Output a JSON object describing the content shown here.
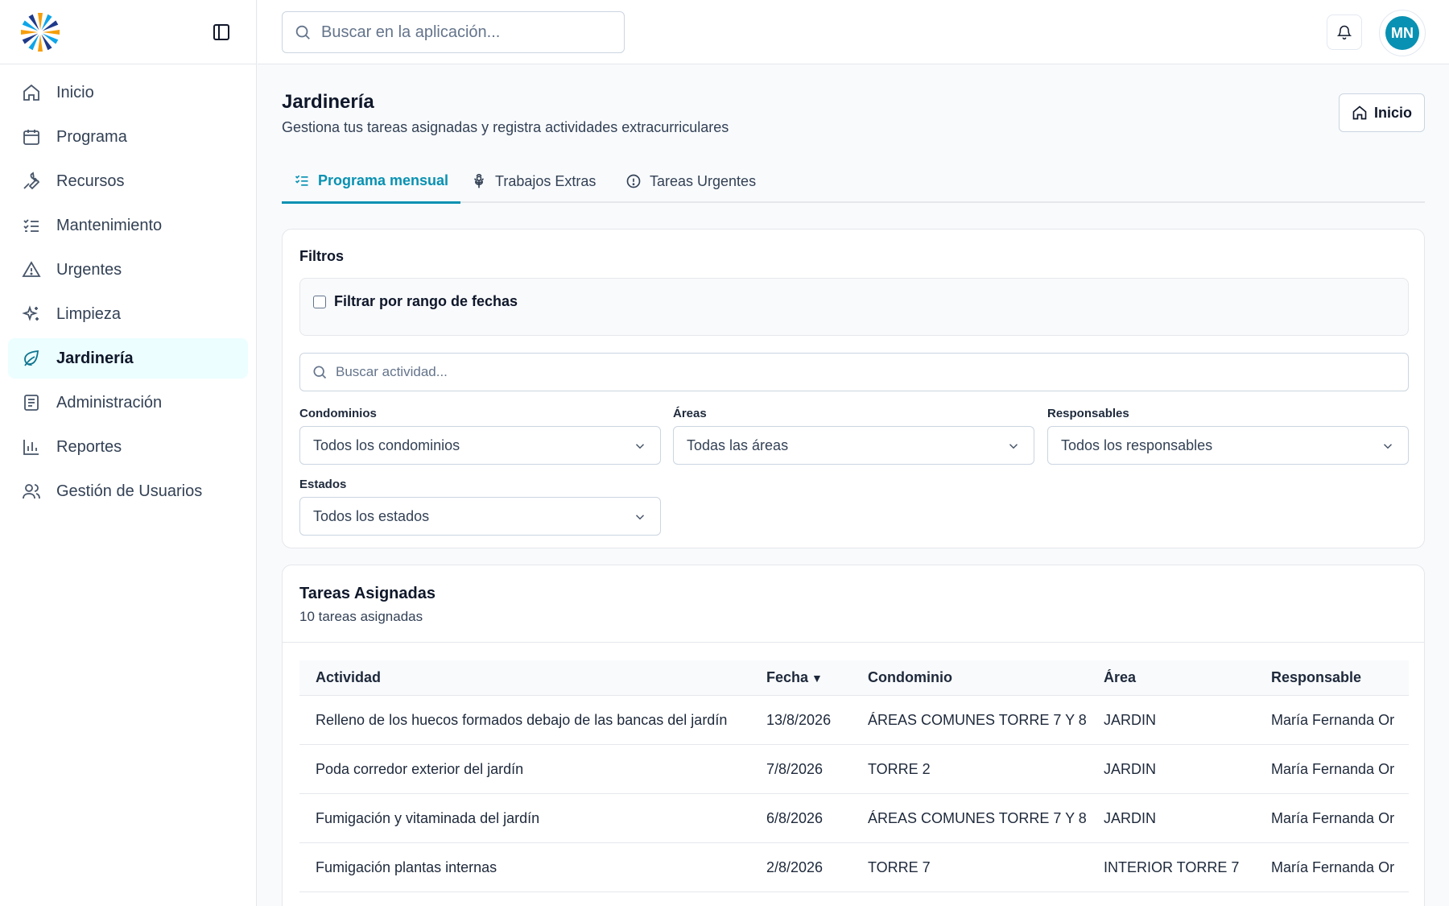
{
  "topbar": {
    "search_placeholder": "Buscar en la aplicación...",
    "avatar_initials": "MN"
  },
  "sidebar": {
    "items": [
      {
        "label": "Inicio",
        "icon": "home-icon"
      },
      {
        "label": "Programa",
        "icon": "calendar-icon"
      },
      {
        "label": "Recursos",
        "icon": "wrench-icon"
      },
      {
        "label": "Mantenimiento",
        "icon": "list-checks-icon"
      },
      {
        "label": "Urgentes",
        "icon": "alert-triangle-icon"
      },
      {
        "label": "Limpieza",
        "icon": "sparkles-icon"
      },
      {
        "label": "Jardinería",
        "icon": "leaf-icon",
        "active": true
      },
      {
        "label": "Administración",
        "icon": "document-icon"
      },
      {
        "label": "Reportes",
        "icon": "bar-chart-icon"
      },
      {
        "label": "Gestión de Usuarios",
        "icon": "users-icon"
      }
    ]
  },
  "header": {
    "title": "Jardinería",
    "subtitle": "Gestiona tus tareas asignadas y registra actividades extracurriculares",
    "home_button": "Inicio"
  },
  "tabs": [
    {
      "label": "Programa mensual",
      "icon": "list-checks-icon",
      "active": true
    },
    {
      "label": "Trabajos Extras",
      "icon": "flower-icon"
    },
    {
      "label": "Tareas Urgentes",
      "icon": "alert-circle-icon"
    }
  ],
  "filters": {
    "title": "Filtros",
    "date_range_label": "Filtrar por rango de fechas",
    "activity_search_placeholder": "Buscar actividad...",
    "condominios": {
      "label": "Condominios",
      "value": "Todos los condominios"
    },
    "areas": {
      "label": "Áreas",
      "value": "Todas las áreas"
    },
    "responsables": {
      "label": "Responsables",
      "value": "Todos los responsables"
    },
    "estados": {
      "label": "Estados",
      "value": "Todos los estados"
    }
  },
  "tasks": {
    "title": "Tareas Asignadas",
    "count_text": "10 tareas asignadas",
    "columns": [
      "Actividad",
      "Fecha",
      "Condominio",
      "Área",
      "Responsable"
    ],
    "sort_indicator": "▼",
    "rows": [
      [
        "Relleno de los huecos formados debajo de las bancas del jardín",
        "13/8/2026",
        "ÁREAS COMUNES TORRE 7 Y 8",
        "JARDIN",
        "María Fernanda Or"
      ],
      [
        "Poda corredor exterior del jardín",
        "7/8/2026",
        "TORRE 2",
        "JARDIN",
        "María Fernanda Or"
      ],
      [
        "Fumigación y vitaminada del jardín",
        "6/8/2026",
        "ÁREAS COMUNES TORRE 7 Y 8",
        "JARDIN",
        "María Fernanda Or"
      ],
      [
        "Fumigación plantas internas",
        "2/8/2026",
        "TORRE 7",
        "INTERIOR TORRE 7",
        "María Fernanda Or"
      ]
    ]
  }
}
